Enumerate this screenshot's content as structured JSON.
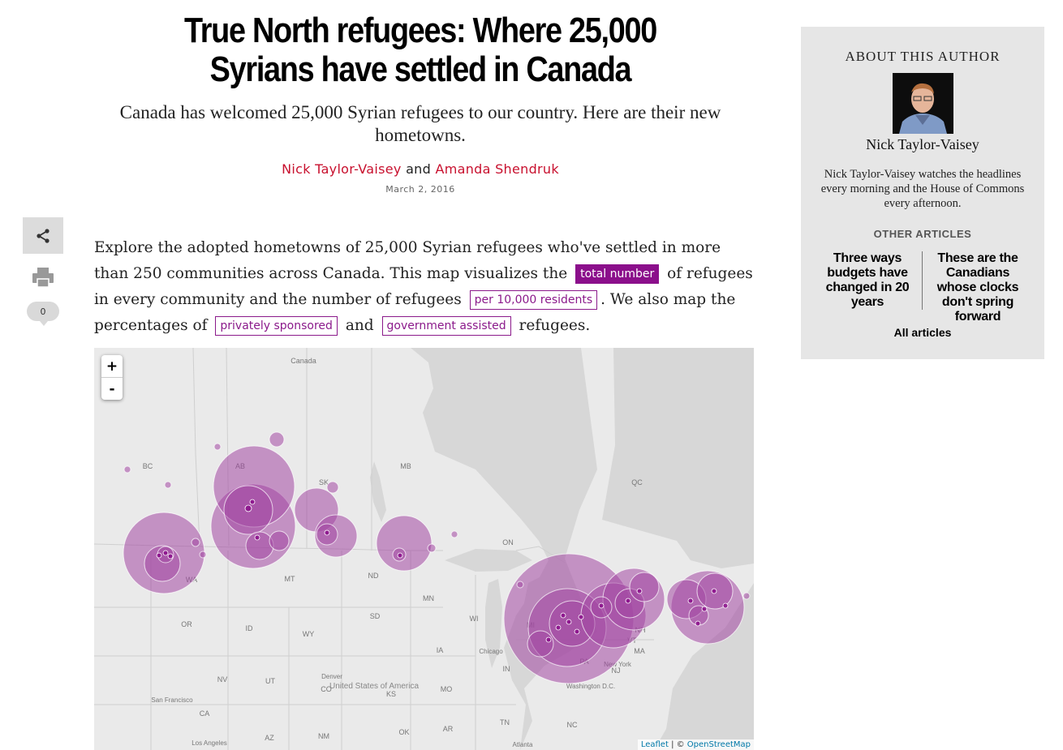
{
  "article": {
    "title": "True North refugees: Where 25,000 Syrians have settled in Canada",
    "dek": "Canada has welcomed 25,000 Syrian refugees to our country. Here are their new hometowns.",
    "author1": "Nick Taylor-Vaisey",
    "byline_and": "and",
    "author2": "Amanda Shendruk",
    "date": "March 2, 2016",
    "intro_1": "Explore the adopted hometowns of 25,000 Syrian refugees who've settled in more than 250 communities across Canada. This map visualizes the",
    "toggle_total": "total number",
    "intro_2": "of refugees in every community and the number of refugees",
    "toggle_per10k": "per 10,000 residents",
    "intro_3": ". We also map the percentages of",
    "toggle_private": "privately sponsored",
    "intro_4": "and",
    "toggle_government": "government assisted",
    "intro_5": "refugees."
  },
  "social": {
    "share_icon": "share-icon",
    "print_icon": "printer-icon",
    "comment_count": "0"
  },
  "map": {
    "zoom_in": "+",
    "zoom_out": "-",
    "attribution_link1": "Leaflet",
    "attribution_sep": " | © ",
    "attribution_link2": "OpenStreetMap",
    "land_color": "#eaeaea",
    "water_color": "#d7d7d7",
    "bubble_color": "#a347a3",
    "labels": {
      "canada": "Canada",
      "bc": "BC",
      "ab": "AB",
      "sk": "SK",
      "mb": "MB",
      "on": "ON",
      "qc": "QC",
      "wa": "WA",
      "mt": "MT",
      "nd": "ND",
      "mn": "MN",
      "or": "OR",
      "id": "ID",
      "wy": "WY",
      "sd": "SD",
      "wi": "WI",
      "mi": "MI",
      "ia": "IA",
      "nv": "NV",
      "ut": "UT",
      "co": "CO",
      "ks": "KS",
      "mo": "MO",
      "in": "IN",
      "nh": "NH",
      "ca": "CA",
      "az": "AZ",
      "nm": "NM",
      "ok": "OK",
      "ar": "AR",
      "tn": "TN",
      "nc": "NC",
      "pa": "PA",
      "nj": "NJ",
      "ma": "MA",
      "vt": "VT",
      "chicago": "Chicago",
      "denver": "Denver",
      "san_francisco": "San Francisco",
      "los_angeles": "Los Angeles",
      "atlanta": "Atlanta",
      "new_york": "New York",
      "washington": "Washington D.C.",
      "united_states": "United States of America"
    }
  },
  "sidebar": {
    "about_heading": "ABOUT THIS AUTHOR",
    "author_name": "Nick Taylor-Vaisey",
    "author_bio": "Nick Taylor-Vaisey watches the headlines every morning and the House of Commons every afternoon.",
    "other_heading": "OTHER ARTICLES",
    "article1": "Three ways budgets have changed in 20 years",
    "article2": "These are the Canadians whose clocks don't spring forward",
    "all_articles": "All articles"
  }
}
